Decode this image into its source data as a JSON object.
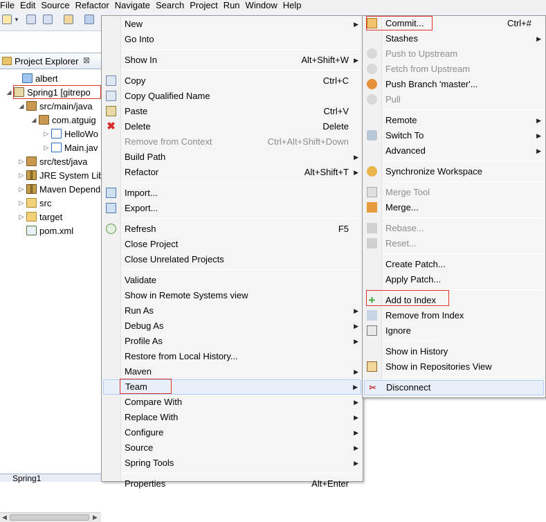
{
  "menubar": [
    "File",
    "Edit",
    "Source",
    "Refactor",
    "Navigate",
    "Search",
    "Project",
    "Run",
    "Window",
    "Help"
  ],
  "explorer": {
    "tab_title": "Project Explorer",
    "close_glyph": "⊠",
    "tree": [
      {
        "label": "albert",
        "icon": "project-icon",
        "twisty": ""
      },
      {
        "label": "Spring1  [gitrepo",
        "icon": "git-project-icon",
        "twisty": "◢"
      },
      {
        "label": "src/main/java",
        "icon": "source-folder-icon",
        "twisty": "◢"
      },
      {
        "label": "com.atguig",
        "icon": "package-icon",
        "twisty": "◢"
      },
      {
        "label": "HelloWo",
        "icon": "java-file-icon",
        "twisty": "▷"
      },
      {
        "label": "Main.jav",
        "icon": "java-file-icon",
        "twisty": "▷"
      },
      {
        "label": "src/test/java",
        "icon": "source-folder-icon",
        "twisty": "▷"
      },
      {
        "label": "JRE System Lib",
        "icon": "library-icon",
        "twisty": "▷"
      },
      {
        "label": "Maven Depend",
        "icon": "library-icon",
        "twisty": "▷"
      },
      {
        "label": "src",
        "icon": "folder-icon",
        "twisty": "▷"
      },
      {
        "label": "target",
        "icon": "folder-icon",
        "twisty": "▷"
      },
      {
        "label": "pom.xml",
        "icon": "xml-file-icon",
        "twisty": ""
      }
    ],
    "bottom_tab": "Spring1"
  },
  "context_menu": {
    "items": [
      {
        "label": "New",
        "accel": "",
        "submenu": true,
        "icon": "",
        "disabled": false
      },
      {
        "label": "Go Into",
        "accel": "",
        "submenu": false,
        "icon": "",
        "disabled": false
      },
      {
        "label": "Show In",
        "accel": "Alt+Shift+W",
        "submenu": true,
        "icon": "",
        "disabled": false
      },
      {
        "label": "Copy",
        "accel": "Ctrl+C",
        "submenu": false,
        "icon": "copy-icon",
        "disabled": false
      },
      {
        "label": "Copy Qualified Name",
        "accel": "",
        "submenu": false,
        "icon": "copy-qualified-icon",
        "disabled": false
      },
      {
        "label": "Paste",
        "accel": "Ctrl+V",
        "submenu": false,
        "icon": "paste-icon",
        "disabled": false
      },
      {
        "label": "Delete",
        "accel": "Delete",
        "submenu": false,
        "icon": "delete-icon",
        "disabled": false
      },
      {
        "label": "Remove from Context",
        "accel": "Ctrl+Alt+Shift+Down",
        "submenu": false,
        "icon": "",
        "disabled": true
      },
      {
        "label": "Build Path",
        "accel": "",
        "submenu": true,
        "icon": "",
        "disabled": false
      },
      {
        "label": "Refactor",
        "accel": "Alt+Shift+T",
        "submenu": true,
        "icon": "",
        "disabled": false
      },
      {
        "label": "Import...",
        "accel": "",
        "submenu": false,
        "icon": "import-icon",
        "disabled": false
      },
      {
        "label": "Export...",
        "accel": "",
        "submenu": false,
        "icon": "export-icon",
        "disabled": false
      },
      {
        "label": "Refresh",
        "accel": "F5",
        "submenu": false,
        "icon": "refresh-icon",
        "disabled": false
      },
      {
        "label": "Close Project",
        "accel": "",
        "submenu": false,
        "icon": "",
        "disabled": false
      },
      {
        "label": "Close Unrelated Projects",
        "accel": "",
        "submenu": false,
        "icon": "",
        "disabled": false
      },
      {
        "label": "Validate",
        "accel": "",
        "submenu": false,
        "icon": "",
        "disabled": false
      },
      {
        "label": "Show in Remote Systems view",
        "accel": "",
        "submenu": false,
        "icon": "",
        "disabled": false
      },
      {
        "label": "Run As",
        "accel": "",
        "submenu": true,
        "icon": "",
        "disabled": false
      },
      {
        "label": "Debug As",
        "accel": "",
        "submenu": true,
        "icon": "",
        "disabled": false
      },
      {
        "label": "Profile As",
        "accel": "",
        "submenu": true,
        "icon": "",
        "disabled": false
      },
      {
        "label": "Restore from Local History...",
        "accel": "",
        "submenu": false,
        "icon": "",
        "disabled": false
      },
      {
        "label": "Maven",
        "accel": "",
        "submenu": true,
        "icon": "",
        "disabled": false
      },
      {
        "label": "Team",
        "accel": "",
        "submenu": true,
        "icon": "",
        "disabled": false
      },
      {
        "label": "Compare With",
        "accel": "",
        "submenu": true,
        "icon": "",
        "disabled": false
      },
      {
        "label": "Replace With",
        "accel": "",
        "submenu": true,
        "icon": "",
        "disabled": false
      },
      {
        "label": "Configure",
        "accel": "",
        "submenu": true,
        "icon": "",
        "disabled": false
      },
      {
        "label": "Source",
        "accel": "",
        "submenu": true,
        "icon": "",
        "disabled": false
      },
      {
        "label": "Spring Tools",
        "accel": "",
        "submenu": true,
        "icon": "",
        "disabled": false
      }
    ],
    "cutoff_label": "Properties",
    "cutoff_accel": "Alt+Enter"
  },
  "team_menu": {
    "items": [
      {
        "label": "Commit...",
        "accel": "Ctrl+#",
        "submenu": false,
        "icon": "commit-icon",
        "disabled": false
      },
      {
        "label": "Stashes",
        "accel": "",
        "submenu": true,
        "icon": "",
        "disabled": false
      },
      {
        "label": "Push to Upstream",
        "accel": "",
        "submenu": false,
        "icon": "push-upstream-icon",
        "disabled": true
      },
      {
        "label": "Fetch from Upstream",
        "accel": "",
        "submenu": false,
        "icon": "fetch-upstream-icon",
        "disabled": true
      },
      {
        "label": "Push Branch 'master'...",
        "accel": "",
        "submenu": false,
        "icon": "push-branch-icon",
        "disabled": false
      },
      {
        "label": "Pull",
        "accel": "",
        "submenu": false,
        "icon": "pull-icon",
        "disabled": true
      },
      {
        "label": "Remote",
        "accel": "",
        "submenu": true,
        "icon": "",
        "disabled": false
      },
      {
        "label": "Switch To",
        "accel": "",
        "submenu": true,
        "icon": "switch-icon",
        "disabled": false
      },
      {
        "label": "Advanced",
        "accel": "",
        "submenu": true,
        "icon": "",
        "disabled": false
      },
      {
        "label": "Synchronize Workspace",
        "accel": "",
        "submenu": false,
        "icon": "synchronize-icon",
        "disabled": false
      },
      {
        "label": "Merge Tool",
        "accel": "",
        "submenu": false,
        "icon": "merge-tool-icon",
        "disabled": true
      },
      {
        "label": "Merge...",
        "accel": "",
        "submenu": false,
        "icon": "merge-icon",
        "disabled": false
      },
      {
        "label": "Rebase...",
        "accel": "",
        "submenu": false,
        "icon": "rebase-icon",
        "disabled": true
      },
      {
        "label": "Reset...",
        "accel": "",
        "submenu": false,
        "icon": "reset-icon",
        "disabled": true
      },
      {
        "label": "Create Patch...",
        "accel": "",
        "submenu": false,
        "icon": "",
        "disabled": false
      },
      {
        "label": "Apply Patch...",
        "accel": "",
        "submenu": false,
        "icon": "",
        "disabled": false
      },
      {
        "label": "Add to Index",
        "accel": "",
        "submenu": false,
        "icon": "add-index-icon",
        "disabled": false
      },
      {
        "label": "Remove from Index",
        "accel": "",
        "submenu": false,
        "icon": "remove-index-icon",
        "disabled": false
      },
      {
        "label": "Ignore",
        "accel": "",
        "submenu": false,
        "icon": "ignore-icon",
        "disabled": false
      },
      {
        "label": "Show in History",
        "accel": "",
        "submenu": false,
        "icon": "",
        "disabled": false
      },
      {
        "label": "Show in Repositories View",
        "accel": "",
        "submenu": false,
        "icon": "git-repo-icon",
        "disabled": false
      },
      {
        "label": "Disconnect",
        "accel": "",
        "submenu": false,
        "icon": "disconnect-icon",
        "disabled": false
      }
    ]
  },
  "glyphs": {
    "submenu_arrow": "▶"
  },
  "colors": {
    "annotation_red": "#e0302b",
    "highlight": "#e8eff8"
  }
}
